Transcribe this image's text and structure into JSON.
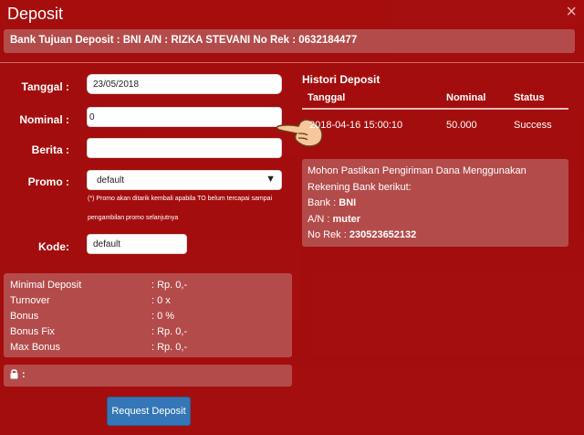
{
  "modal": {
    "title": "Deposit",
    "close_symbol": "×"
  },
  "bank": {
    "text": "Bank Tujuan Deposit : BNI A/N : RIZKA STEVANI No Rek : 0632184477"
  },
  "form": {
    "tanggal_label": "Tanggal :",
    "tanggal_value": "23/05/2018",
    "nominal_label": "Nominal :",
    "nominal_value": "0",
    "berita_label": "Berita :",
    "berita_value": "",
    "promo_label": "Promo :",
    "promo_selected": "default",
    "promo_note_1": "(*) Promo akan ditarik kembali apabila TO belum tercapai sampai",
    "promo_note_2": "pengambilan promo selanjutnya",
    "kode_label": "Kode:",
    "kode_value": "default"
  },
  "history": {
    "title": "Histori Deposit",
    "columns": [
      "Tanggal",
      "Nominal",
      "Status"
    ],
    "rows": [
      [
        "2018-04-16 15:00:10",
        "50.000",
        "Success"
      ]
    ]
  },
  "info": {
    "line1": "Mohon Pastikan Pengiriman Dana Menggunakan",
    "line2": "Rekening Bank berikut:",
    "bank_label": "Bank : ",
    "bank_value": "BNI",
    "an_label": "A/N : ",
    "an_value": "muter",
    "rek_label": "No Rek : ",
    "rek_value": "230523652132"
  },
  "limits": [
    {
      "label": "Minimal Deposit",
      "value": ": Rp. 0,-"
    },
    {
      "label": "Turnover",
      "value": ": 0 x"
    },
    {
      "label": "Bonus",
      "value": ": 0 %"
    },
    {
      "label": "Bonus Fix",
      "value": ": Rp. 0,-"
    },
    {
      "label": "Max Bonus",
      "value": ": Rp. 0,-"
    }
  ],
  "lock": {
    "text": ":"
  },
  "submit": {
    "label": "Request Deposit"
  },
  "colors": {
    "modal_bg": "#a50c0c",
    "panel_bg": "#b44b4b",
    "button_bg": "#3476b6"
  },
  "icons": {
    "pointer": "pointing-hand-icon",
    "lock": "lock-icon",
    "close": "close-icon"
  }
}
